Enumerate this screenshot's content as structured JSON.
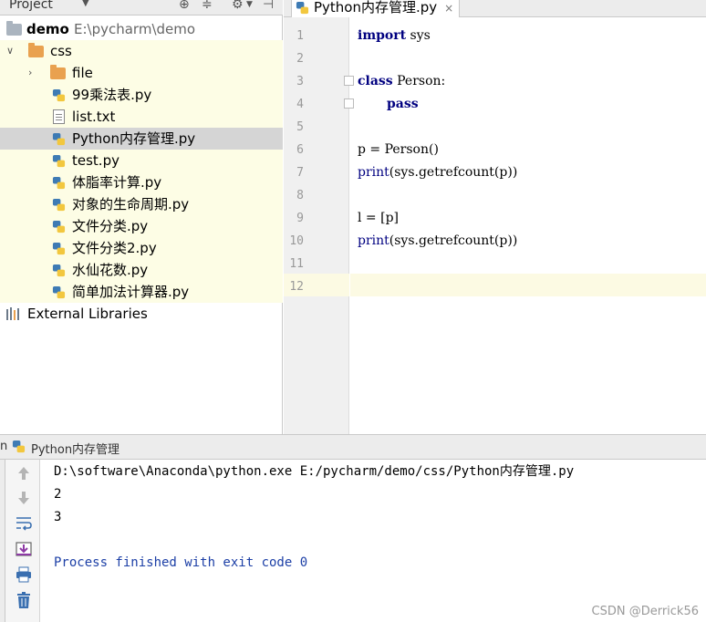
{
  "project_panel": {
    "title": "Project",
    "root": {
      "name": "demo",
      "path": "E:\\pycharm\\demo"
    },
    "folder_css": "css",
    "folder_file": "file",
    "files": [
      "99乘法表.py",
      "list.txt",
      "Python内存管理.py",
      "test.py",
      "体脂率计算.py",
      "对象的生命周期.py",
      "文件分类.py",
      "文件分类2.py",
      "水仙花数.py",
      "简单加法计算器.py"
    ],
    "external_libraries": "External Libraries"
  },
  "editor": {
    "tab_label": "Python内存管理.py",
    "tab_close": "×",
    "line_numbers": [
      "1",
      "2",
      "3",
      "4",
      "5",
      "6",
      "7",
      "8",
      "9",
      "10",
      "11",
      "12"
    ],
    "code": {
      "l1_kw": "import",
      "l1_rest": " sys",
      "l3_kw": "class",
      "l3_rest": " Person:",
      "l4_kw": "pass",
      "l6": "p = Person()",
      "l7_fn": "print",
      "l7_rest": "(sys.getrefcount(p))",
      "l9": "l = [p]",
      "l10_fn": "print",
      "l10_rest": "(sys.getrefcount(p))"
    }
  },
  "run_panel": {
    "label": "n",
    "config_name": "Python内存管理",
    "output": [
      "D:\\software\\Anaconda\\python.exe E:/pycharm/demo/css/Python内存管理.py",
      "2",
      "3",
      "",
      "Process finished with exit code 0"
    ]
  },
  "watermark": "CSDN @Derrick56",
  "icons": {
    "header": [
      "crosshair-icon",
      "collapse-icon",
      "gear-icon",
      "hide-icon"
    ],
    "run_toolbar": [
      "up-arrow-icon",
      "down-arrow-icon",
      "soft-wrap-icon",
      "scroll-to-end-icon",
      "print-icon",
      "trash-icon"
    ]
  }
}
